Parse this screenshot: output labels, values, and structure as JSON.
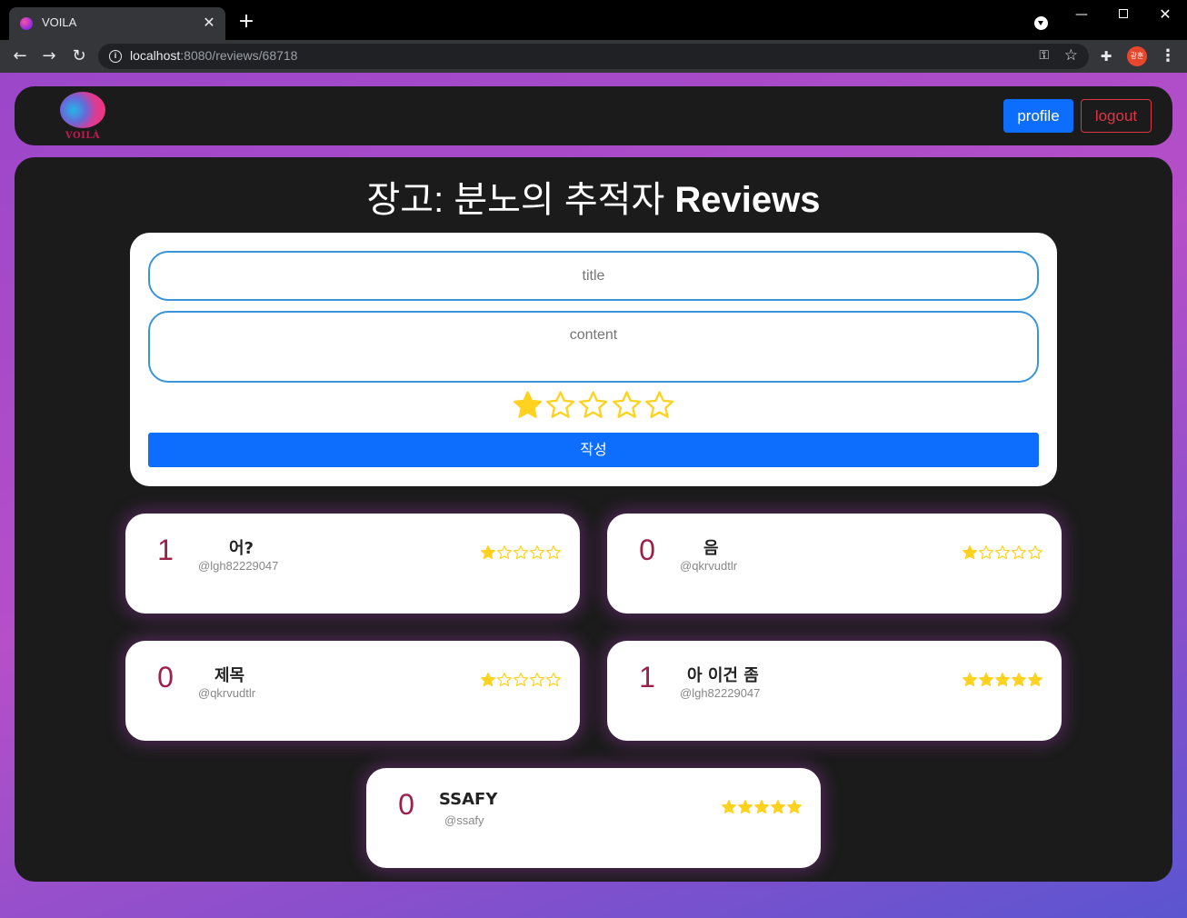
{
  "browser": {
    "tab_title": "VOILA",
    "url_host": "localhost",
    "url_rest": ":8080/reviews/68718",
    "avatar_text": "광훈"
  },
  "navbar": {
    "logo_text": "VOILÀ",
    "profile_label": "profile",
    "logout_label": "logout"
  },
  "page": {
    "title_movie": "장고: 분노의 추적자",
    "title_suffix": "Reviews"
  },
  "form": {
    "title_placeholder": "title",
    "content_placeholder": "content",
    "rating": 1,
    "max_rating": 5,
    "submit_label": "작성"
  },
  "reviews": [
    {
      "count": "1",
      "title": "어?",
      "author": "@lgh82229047",
      "rating": 1
    },
    {
      "count": "0",
      "title": "음",
      "author": "@qkrvudtlr",
      "rating": 1
    },
    {
      "count": "0",
      "title": "제목",
      "author": "@qkrvudtlr",
      "rating": 1
    },
    {
      "count": "1",
      "title": "아 이건 좀",
      "author": "@lgh82229047",
      "rating": 5
    },
    {
      "count": "0",
      "title": "SSAFY",
      "author": "@ssafy",
      "rating": 5
    }
  ],
  "colors": {
    "star": "#ffd21f",
    "accent_blue": "#0d6efd",
    "danger": "#dc3545",
    "count": "#9b2148"
  },
  "icons": {
    "star_filled": "star-filled-icon",
    "star_empty": "star-empty-icon"
  }
}
